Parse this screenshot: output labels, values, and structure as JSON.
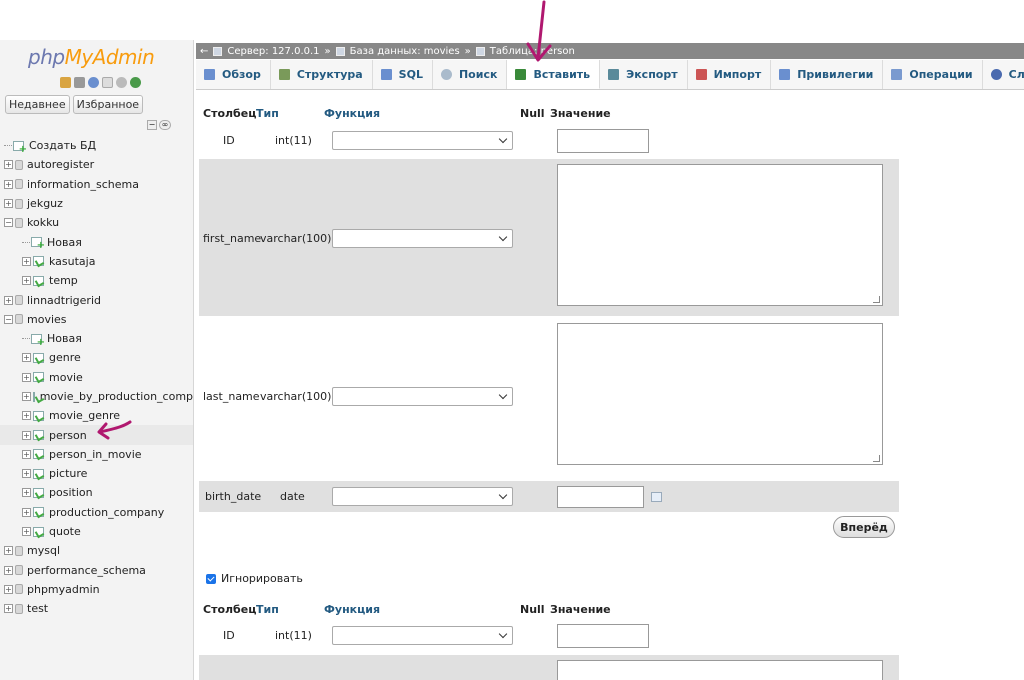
{
  "app": {
    "logo_php": "php",
    "logo_my": "MyAdmin"
  },
  "sidebar": {
    "tab_recent": "Недавнее",
    "tab_favorites": "Избранное",
    "create_db": "Создать БД",
    "databases": [
      {
        "name": "autoregister"
      },
      {
        "name": "information_schema"
      },
      {
        "name": "jekguz"
      },
      {
        "name": "kokku",
        "children": [
          "Новая",
          "kasutaja",
          "temp"
        ]
      },
      {
        "name": "linnadtrigerid"
      },
      {
        "name": "movies",
        "children": [
          "Новая",
          "genre",
          "movie",
          "movie_by_production_compa",
          "movie_genre",
          "person",
          "person_in_movie",
          "picture",
          "position",
          "production_company",
          "quote"
        ]
      },
      {
        "name": "mysql"
      },
      {
        "name": "performance_schema"
      },
      {
        "name": "phpmyadmin"
      },
      {
        "name": "test"
      }
    ],
    "selected_table": "person"
  },
  "breadcrumb": {
    "server": "Сервер: 127.0.0.1",
    "sep1": "»",
    "database": "База данных: movies",
    "sep2": "»",
    "table": "Таблица: person"
  },
  "tabs": [
    {
      "label": "Обзор",
      "icon": "browse-icon",
      "color": "#6a8fcf"
    },
    {
      "label": "Структура",
      "icon": "structure-icon",
      "color": "#7a9a5a"
    },
    {
      "label": "SQL",
      "icon": "sql-icon",
      "color": "#6a8fcf"
    },
    {
      "label": "Поиск",
      "icon": "search-icon",
      "color": "#9ab"
    },
    {
      "label": "Вставить",
      "icon": "insert-icon",
      "color": "#3a8a3a",
      "active": true
    },
    {
      "label": "Экспорт",
      "icon": "export-icon",
      "color": "#5a8a9a"
    },
    {
      "label": "Импорт",
      "icon": "import-icon",
      "color": "#c55"
    },
    {
      "label": "Привилегии",
      "icon": "privileges-icon",
      "color": "#6a8fcf"
    },
    {
      "label": "Операции",
      "icon": "operations-icon",
      "color": "#7a9acf"
    },
    {
      "label": "Слежение",
      "icon": "tracking-icon",
      "color": "#4a6aaf"
    }
  ],
  "form": {
    "header": {
      "column": "Столбец",
      "type": "Тип",
      "function": "Функция",
      "null": "Null",
      "value": "Значение"
    },
    "rows": [
      {
        "column": "ID",
        "type": "int(11)"
      },
      {
        "column": "first_name",
        "type": "varchar(100)"
      },
      {
        "column": "last_name",
        "type": "varchar(100)"
      },
      {
        "column": "birth_date",
        "type": "date"
      }
    ],
    "go_button": "Вперёд",
    "ignore_label": "Игнорировать",
    "second_header": {
      "column": "Столбец",
      "type": "Тип",
      "function": "Функция",
      "null": "Null",
      "value": "Значение"
    },
    "second_rows": [
      {
        "column": "ID",
        "type": "int(11)"
      }
    ]
  },
  "colors": {
    "annotation": "#b0186f",
    "link": "#235a81",
    "breadcrumb_bg": "#888888"
  }
}
